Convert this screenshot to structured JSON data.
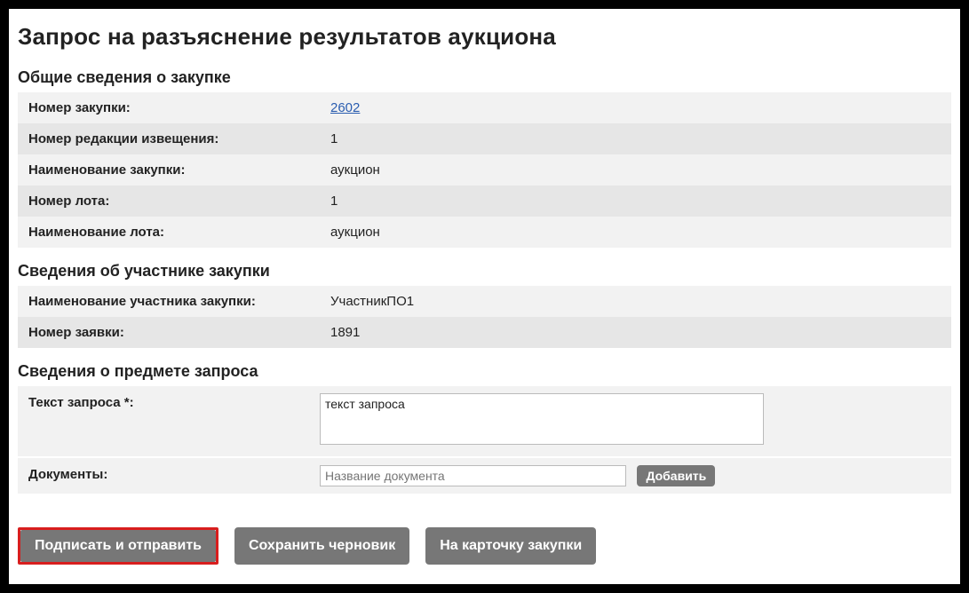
{
  "page_title": "Запрос на разъяснение результатов аукциона",
  "sections": {
    "general": {
      "title": "Общие сведения о закупке",
      "rows": {
        "purchase_number_label": "Номер закупки:",
        "purchase_number_value": "2602",
        "notice_revision_label": "Номер редакции извещения:",
        "notice_revision_value": "1",
        "purchase_name_label": "Наименование закупки:",
        "purchase_name_value": "аукцион",
        "lot_number_label": "Номер лота:",
        "lot_number_value": "1",
        "lot_name_label": "Наименование лота:",
        "lot_name_value": "аукцион"
      }
    },
    "participant": {
      "title": "Сведения об участнике закупки",
      "rows": {
        "participant_name_label": "Наименование участника закупки:",
        "participant_name_value": "УчастникПО1",
        "application_number_label": "Номер заявки:",
        "application_number_value": "1891"
      }
    },
    "request": {
      "title": "Сведения о предмете запроса",
      "text_label": "Текст запроса *:",
      "text_value": "текст запроса",
      "documents_label": "Документы:",
      "documents_placeholder": "Название документа",
      "add_button": "Добавить"
    }
  },
  "actions": {
    "sign_send": "Подписать и отправить",
    "save_draft": "Сохранить черновик",
    "to_card": "На карточку закупки"
  }
}
